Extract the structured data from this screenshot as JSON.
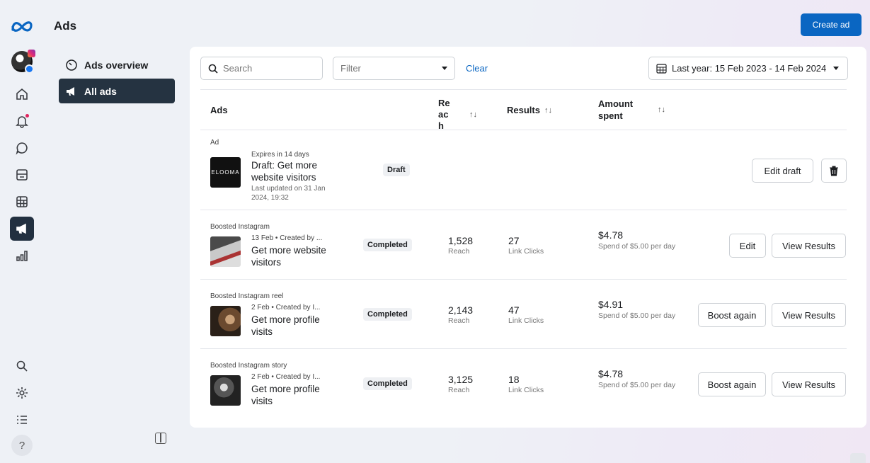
{
  "page": {
    "title": "Ads",
    "create_label": "Create ad"
  },
  "sidebar": {
    "items": [
      {
        "label": "Ads overview",
        "icon": "gauge-icon"
      },
      {
        "label": "All ads",
        "icon": "megaphone-icon"
      }
    ]
  },
  "toolbar": {
    "search_placeholder": "Search",
    "filter_placeholder": "Filter",
    "clear_label": "Clear",
    "date_range": "Last year: 15 Feb 2023 - 14 Feb 2024"
  },
  "table": {
    "headers": {
      "ads": "Ads",
      "reach": "Reach",
      "results": "Results",
      "amount": "Amount spent",
      "sort_glyph": "↑↓"
    },
    "rows": [
      {
        "type": "Ad",
        "meta": "Expires in 14 days",
        "title": "Draft: Get more website visitors",
        "updated": "Last updated on 31 Jan 2024, 19:32",
        "thumb_text": "ELOOMA",
        "status": "Draft",
        "actions": [
          "Edit draft"
        ]
      },
      {
        "type": "Boosted Instagram",
        "meta": "13 Feb • Created by ...",
        "title": "Get more website visitors",
        "status": "Completed",
        "reach": "1,528",
        "reach_label": "Reach",
        "results": "27",
        "results_label": "Link Clicks",
        "amount": "$4.78",
        "spend_note": "Spend of $5.00 per day",
        "actions": [
          "Edit",
          "View Results"
        ]
      },
      {
        "type": "Boosted Instagram reel",
        "meta": "2 Feb • Created by I...",
        "title": "Get more profile visits",
        "status": "Completed",
        "reach": "2,143",
        "reach_label": "Reach",
        "results": "47",
        "results_label": "Link Clicks",
        "amount": "$4.91",
        "spend_note": "Spend of $5.00 per day",
        "actions": [
          "Boost again",
          "View Results"
        ]
      },
      {
        "type": "Boosted Instagram story",
        "meta": "2 Feb • Created by I...",
        "title": "Get more profile visits",
        "status": "Completed",
        "reach": "3,125",
        "reach_label": "Reach",
        "results": "18",
        "results_label": "Link Clicks",
        "amount": "$4.78",
        "spend_note": "Spend of $5.00 per day",
        "actions": [
          "Boost again",
          "View Results"
        ]
      }
    ]
  },
  "colors": {
    "accent": "#0a66c2",
    "active_nav": "#253341"
  }
}
